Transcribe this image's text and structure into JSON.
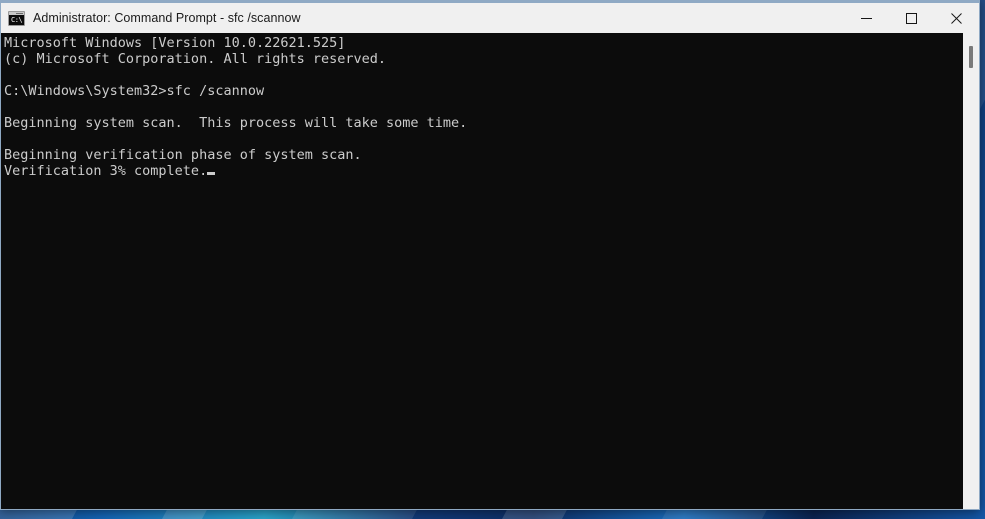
{
  "window": {
    "title": "Administrator: Command Prompt - sfc  /scannow",
    "icon": "command-prompt-icon",
    "icon_glyph": "C:\\",
    "controls": {
      "minimize_label": "Minimize",
      "maximize_label": "Maximize",
      "close_label": "Close"
    }
  },
  "console": {
    "text": "Microsoft Windows [Version 10.0.22621.525]\n(c) Microsoft Corporation. All rights reserved.\n\nC:\\Windows\\System32>sfc /scannow\n\nBeginning system scan.  This process will take some time.\n\nBeginning verification phase of system scan.\nVerification 3% complete.",
    "lines": [
      "Microsoft Windows [Version 10.0.22621.525]",
      "(c) Microsoft Corporation. All rights reserved.",
      "",
      "C:\\Windows\\System32>sfc /scannow",
      "",
      "Beginning system scan.  This process will take some time.",
      "",
      "Beginning verification phase of system scan.",
      "Verification 3% complete."
    ],
    "prompt_path": "C:\\Windows\\System32>",
    "command": "sfc /scannow",
    "os_version": "10.0.22621.525",
    "progress_percent": "3%",
    "cursor": "block-cursor",
    "foreground_color": "#cccccc",
    "background_color": "#0c0c0c"
  },
  "scrollbar": {
    "name": "vertical-scrollbar",
    "thumb": "scroll-thumb"
  }
}
